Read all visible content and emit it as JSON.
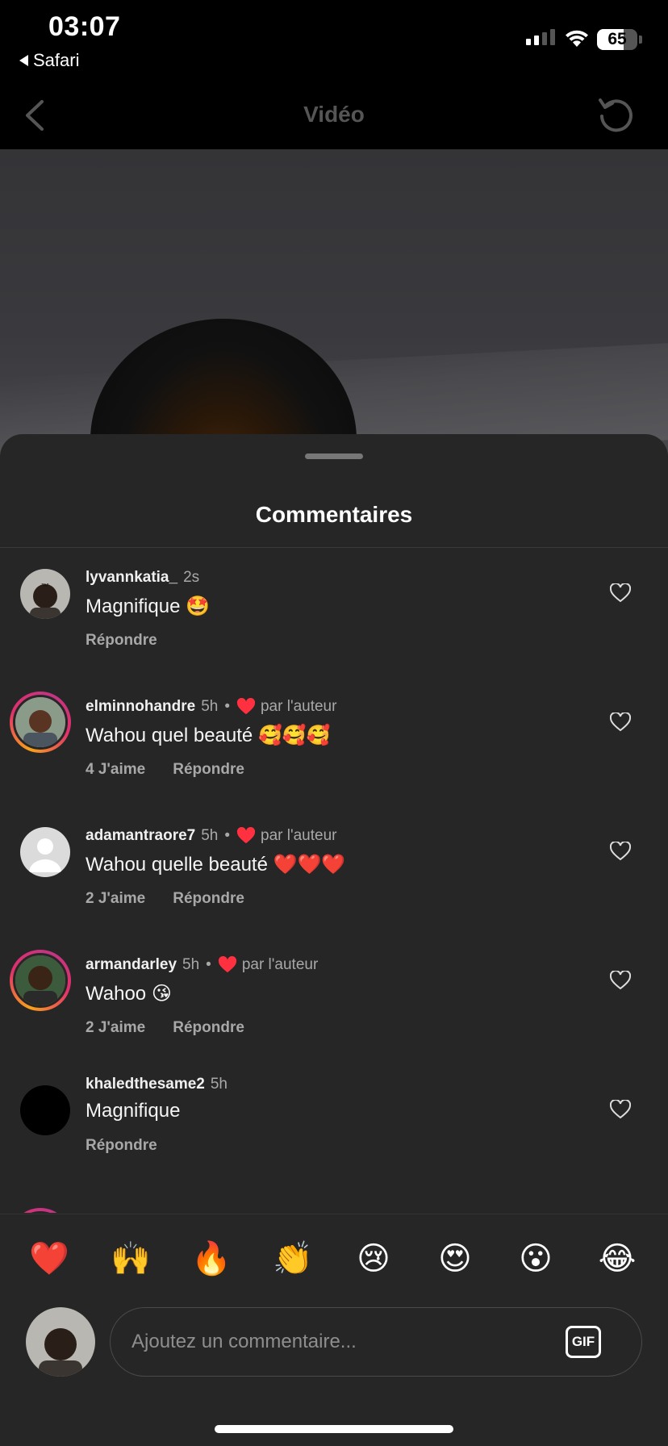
{
  "status_bar": {
    "time": "03:07",
    "back_app": "Safari",
    "battery_percent": 65,
    "battery_label": "65"
  },
  "nav": {
    "title": "Vidéo"
  },
  "sheet": {
    "title": "Commentaires"
  },
  "comments": [
    {
      "user": "lyvannkatia_",
      "age": "2s",
      "text": "Magnifique 🤩",
      "likes": "",
      "reply": "Répondre",
      "liked_by_author": false,
      "avatar_ring": false
    },
    {
      "user": "elminnohandre",
      "age": "5h",
      "text": "Wahou quel beauté 🥰🥰🥰",
      "likes": "4 J'aime",
      "reply": "Répondre",
      "liked_by_author": true,
      "by_author": "par l'auteur",
      "avatar_ring": true
    },
    {
      "user": "adamantraore7",
      "age": "5h",
      "text": "Wahou quelle beauté ❤️❤️❤️",
      "likes": "2 J'aime",
      "reply": "Répondre",
      "liked_by_author": true,
      "by_author": "par l'auteur",
      "avatar_ring": false
    },
    {
      "user": "armandarley",
      "age": "5h",
      "text": "Wahoo 😘",
      "likes": "2 J'aime",
      "reply": "Répondre",
      "liked_by_author": true,
      "by_author": "par l'auteur",
      "avatar_ring": true
    },
    {
      "user": "khaledthesame2",
      "age": "5h",
      "text": "Magnifique",
      "likes": "",
      "reply": "Répondre",
      "liked_by_author": false,
      "avatar_ring": false
    }
  ],
  "emoji_reactions": [
    "❤️",
    "🙌",
    "🔥",
    "👏",
    "😢",
    "😍",
    "😮",
    "😂"
  ],
  "composer": {
    "placeholder": "Ajoutez un commentaire...",
    "gif_label": "GIF"
  },
  "colors": {
    "sheet_bg": "#262626",
    "heart_red": "#ff3040",
    "muted_text": "#a8a8a8"
  }
}
